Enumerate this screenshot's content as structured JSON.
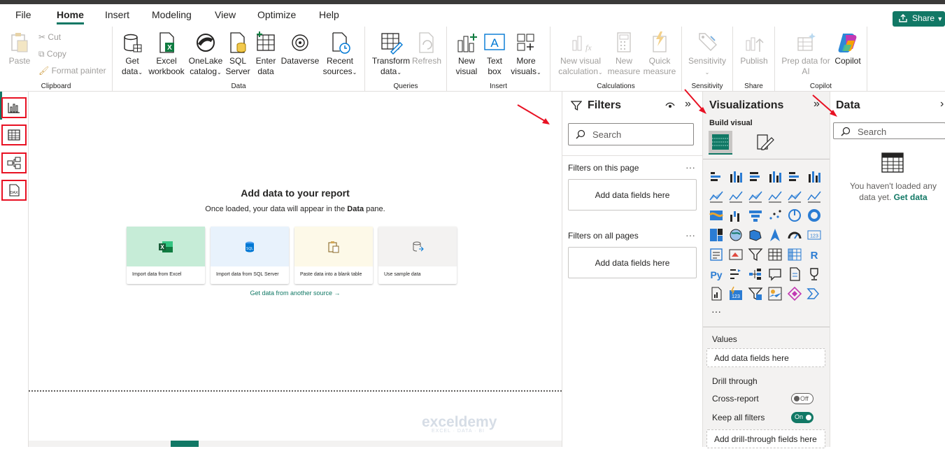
{
  "menu": {
    "tabs": [
      "File",
      "Home",
      "Insert",
      "Modeling",
      "View",
      "Optimize",
      "Help"
    ],
    "active": "Home",
    "share_label": "Share"
  },
  "ribbon": {
    "clipboard": {
      "label": "Clipboard",
      "paste": "Paste",
      "cut": "Cut",
      "copy": "Copy",
      "format_painter": "Format painter"
    },
    "data": {
      "label": "Data",
      "get_data": [
        "Get",
        "data"
      ],
      "excel": [
        "Excel",
        "workbook"
      ],
      "onelake": [
        "OneLake",
        "catalog"
      ],
      "sql": [
        "SQL",
        "Server"
      ],
      "enter": [
        "Enter",
        "data"
      ],
      "dataverse": "Dataverse",
      "recent": [
        "Recent",
        "sources"
      ]
    },
    "queries": {
      "label": "Queries",
      "transform": [
        "Transform",
        "data"
      ],
      "refresh": "Refresh"
    },
    "insert": {
      "label": "Insert",
      "new_visual": [
        "New",
        "visual"
      ],
      "text_box": [
        "Text",
        "box"
      ],
      "more_visuals": [
        "More",
        "visuals"
      ]
    },
    "calculations": {
      "label": "Calculations",
      "new_visual_calc": [
        "New visual",
        "calculation"
      ],
      "new_measure": [
        "New",
        "measure"
      ],
      "quick_measure": [
        "Quick",
        "measure"
      ]
    },
    "sensitivity": {
      "label": "Sensitivity",
      "btn": "Sensitivity"
    },
    "share": {
      "label": "Share",
      "publish": "Publish"
    },
    "copilot": {
      "label": "Copilot",
      "prep": [
        "Prep data for",
        "AI"
      ],
      "copilot": "Copilot"
    }
  },
  "canvas": {
    "heading": "Add data to your report",
    "sub_pre": "Once loaded, your data will appear in the ",
    "sub_bold": "Data",
    "sub_post": " pane.",
    "cards": [
      "Import data from Excel",
      "Import data from SQL Server",
      "Paste data into a blank table",
      "Use sample data"
    ],
    "link": "Get data from another source →",
    "watermark_name": "exceldemy",
    "watermark_tag": "EXCEL · DATA · BI"
  },
  "filters": {
    "title": "Filters",
    "search_placeholder": "Search",
    "on_page": "Filters on this page",
    "on_all": "Filters on all pages",
    "add_fields": "Add data fields here"
  },
  "viz": {
    "title": "Visualizations",
    "build": "Build visual",
    "values": "Values",
    "add_fields": "Add data fields here",
    "drill": "Drill through",
    "cross": "Cross-report",
    "cross_state": "Off",
    "keep": "Keep all filters",
    "keep_state": "On",
    "add_drill": "Add drill-through fields here",
    "more": "···"
  },
  "data_pane": {
    "title": "Data",
    "search_placeholder": "Search",
    "empty_line1": "You haven't loaded any",
    "empty_line2": "data yet. ",
    "get_data": "Get data"
  },
  "colors": {
    "accent": "#117865",
    "highlight": "#e81123",
    "arrow": "#e81123"
  }
}
